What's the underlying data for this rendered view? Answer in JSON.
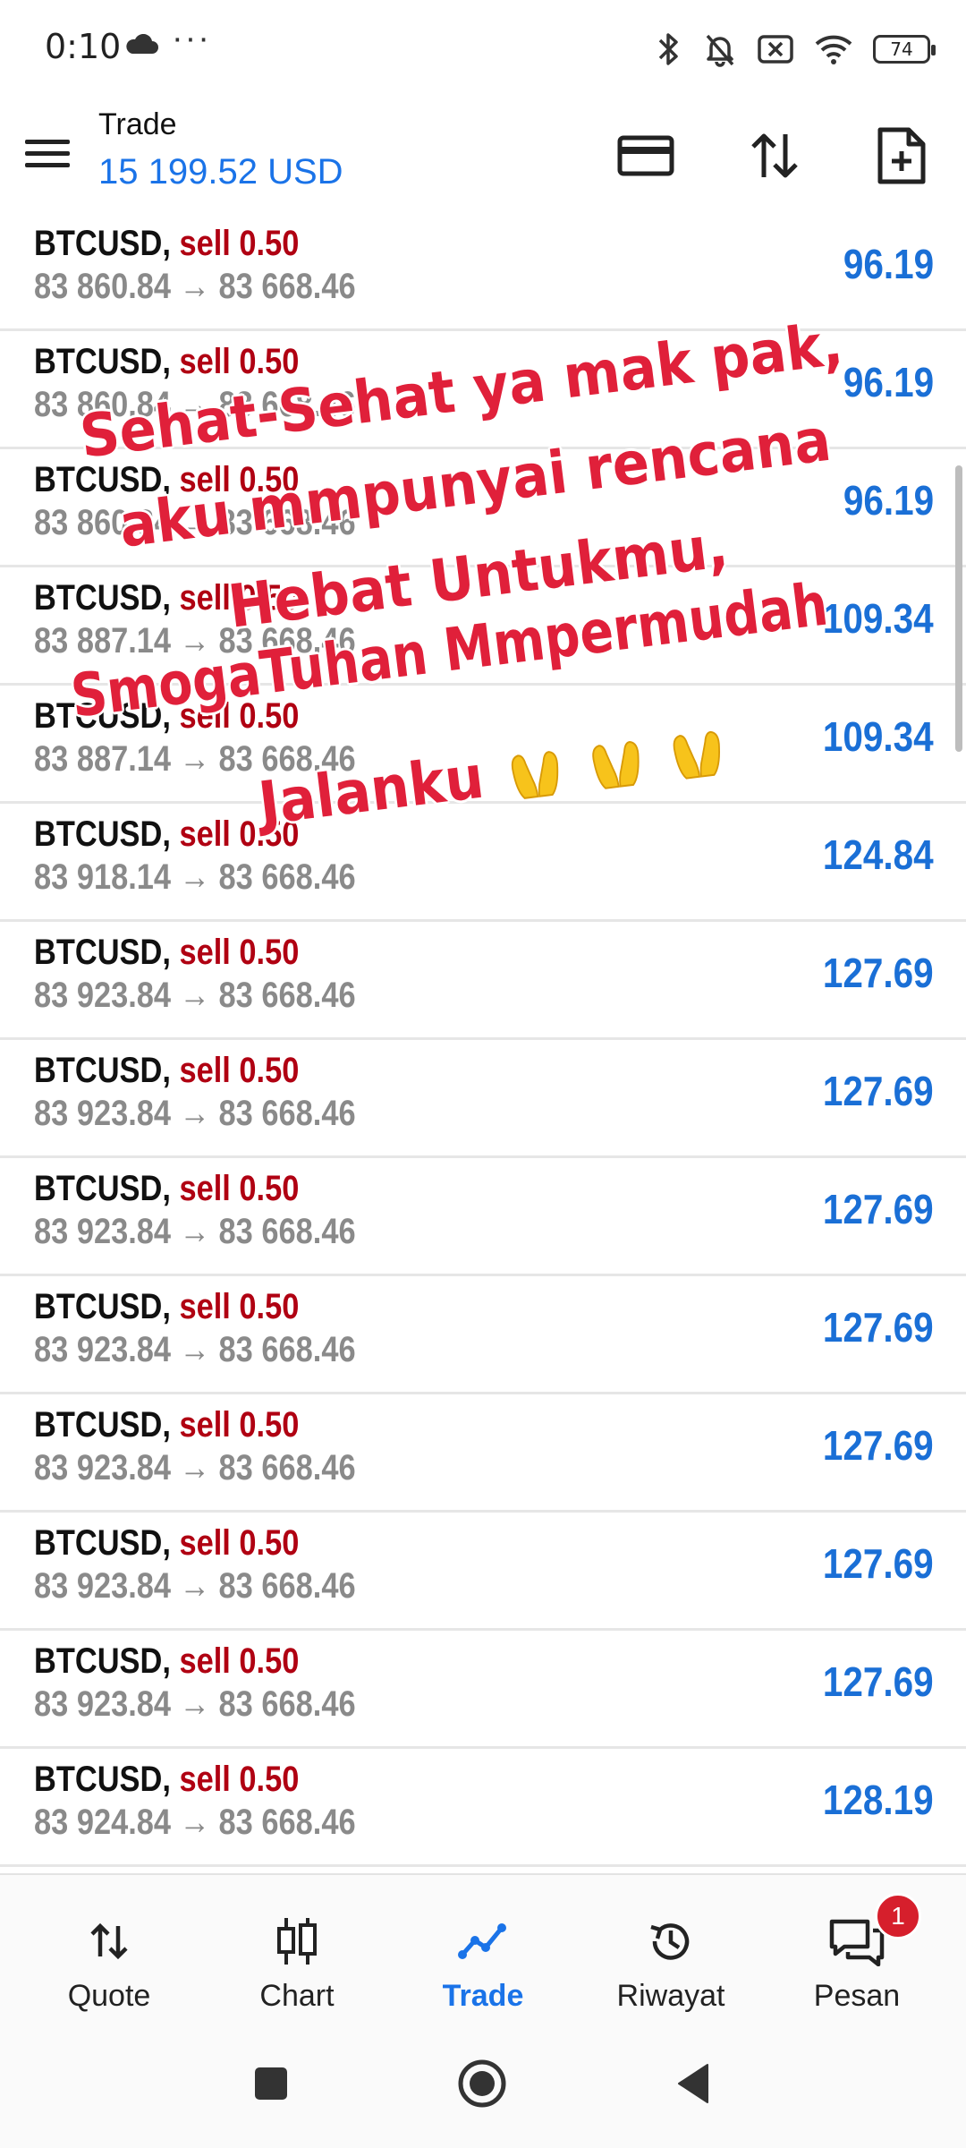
{
  "status_bar": {
    "time": "0:10",
    "overflow_dots": "···",
    "battery": "74"
  },
  "header": {
    "title": "Trade",
    "balance": "15 199.52 USD"
  },
  "trades": [
    {
      "symbol": "BTCUSD,",
      "side": "sell 0.50",
      "prices": "83 860.84 → 83 668.46",
      "profit": "96.19"
    },
    {
      "symbol": "BTCUSD,",
      "side": "sell 0.50",
      "prices": "83 860.84 → 83 668.46",
      "profit": "96.19"
    },
    {
      "symbol": "BTCUSD,",
      "side": "sell 0.50",
      "prices": "83 860.84 → 83 668.46",
      "profit": "96.19"
    },
    {
      "symbol": "BTCUSD,",
      "side": "sell 0.50",
      "prices": "83 887.14 → 83 668.46",
      "profit": "109.34"
    },
    {
      "symbol": "BTCUSD,",
      "side": "sell 0.50",
      "prices": "83 887.14 → 83 668.46",
      "profit": "109.34"
    },
    {
      "symbol": "BTCUSD,",
      "side": "sell 0.50",
      "prices": "83 918.14 → 83 668.46",
      "profit": "124.84"
    },
    {
      "symbol": "BTCUSD,",
      "side": "sell 0.50",
      "prices": "83 923.84 → 83 668.46",
      "profit": "127.69"
    },
    {
      "symbol": "BTCUSD,",
      "side": "sell 0.50",
      "prices": "83 923.84 → 83 668.46",
      "profit": "127.69"
    },
    {
      "symbol": "BTCUSD,",
      "side": "sell 0.50",
      "prices": "83 923.84 → 83 668.46",
      "profit": "127.69"
    },
    {
      "symbol": "BTCUSD,",
      "side": "sell 0.50",
      "prices": "83 923.84 → 83 668.46",
      "profit": "127.69"
    },
    {
      "symbol": "BTCUSD,",
      "side": "sell 0.50",
      "prices": "83 923.84 → 83 668.46",
      "profit": "127.69"
    },
    {
      "symbol": "BTCUSD,",
      "side": "sell 0.50",
      "prices": "83 923.84 → 83 668.46",
      "profit": "127.69"
    },
    {
      "symbol": "BTCUSD,",
      "side": "sell 0.50",
      "prices": "83 923.84 → 83 668.46",
      "profit": "127.69"
    },
    {
      "symbol": "BTCUSD,",
      "side": "sell 0.50",
      "prices": "83 924.84 → 83 668.46",
      "profit": "128.19"
    }
  ],
  "overlay": {
    "lines": [
      "Sehat-Sehat ya mak pak,",
      "aku mmpunyai rencana",
      "Hebat Untukmu,",
      "SmogaTuhan Mmpermudah",
      "Jalanku"
    ],
    "emoji": "palms-up-together-emoji",
    "color": "#e0203a"
  },
  "bottom_nav": {
    "quote": "Quote",
    "chart": "Chart",
    "trade": "Trade",
    "history": "Riwayat",
    "messages": "Pesan",
    "messages_badge": "1"
  },
  "colors": {
    "accent": "#1a73e8",
    "sell": "#b00012",
    "profit": "#1a6fd6",
    "muted": "#8a8a8a"
  }
}
